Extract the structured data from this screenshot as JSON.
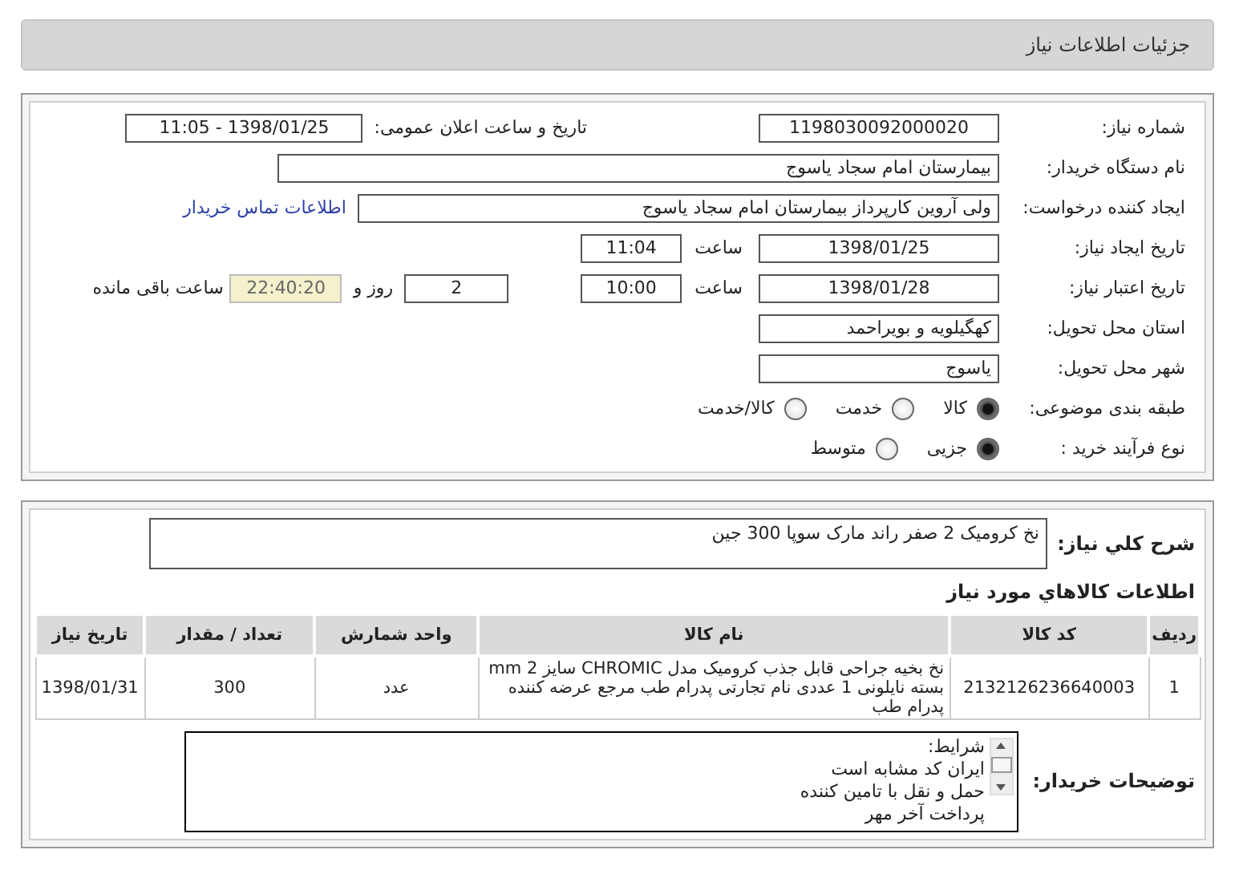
{
  "header": {
    "title": "جزئیات اطلاعات نیاز"
  },
  "need_number": {
    "label": "شماره نیاز:",
    "value": "1198030092000020"
  },
  "announce": {
    "label": "تاریخ و ساعت اعلان عمومی:",
    "value": "1398/01/25 - 11:05"
  },
  "buyer": {
    "label": "نام دستگاه خریدار:",
    "value": "بیمارستان امام سجاد یاسوج"
  },
  "creator": {
    "label": "ایجاد کننده درخواست:",
    "value": "ولی آروین کارپرداز بیمارستان امام سجاد یاسوج",
    "link": "اطلاعات تماس خریدار"
  },
  "created": {
    "label": "تاریخ ایجاد نیاز:",
    "date": "1398/01/25",
    "time_label": "ساعت",
    "time": "11:04"
  },
  "valid": {
    "label": "تاریخ اعتبار نیاز:",
    "date": "1398/01/28",
    "time_label": "ساعت",
    "time": "10:00",
    "days": "2",
    "days_label": "روز و",
    "remaining": "22:40:20",
    "remaining_label": "ساعت باقی مانده"
  },
  "province": {
    "label": "استان محل تحویل:",
    "value": "کهگیلویه و بویراحمد"
  },
  "city": {
    "label": "شهر محل تحویل:",
    "value": "یاسوج"
  },
  "category": {
    "label": "طبقه بندی موضوعی:",
    "options": [
      {
        "label": "کالا",
        "selected": true
      },
      {
        "label": "خدمت",
        "selected": false
      },
      {
        "label": "کالا/خدمت",
        "selected": false
      }
    ]
  },
  "process": {
    "label": "نوع فرآیند خرید :",
    "options": [
      {
        "label": "جزیی",
        "selected": true
      },
      {
        "label": "متوسط",
        "selected": false
      }
    ]
  },
  "summary": {
    "label": "شرح کلي نياز:",
    "value": "نخ کرومیک 2 صفر راند  مارک سوپا 300 جین"
  },
  "goods": {
    "title": "اطلاعات کالاهاي مورد نياز",
    "columns": [
      "ردیف",
      "کد کالا",
      "نام کالا",
      "واحد شمارش",
      "تعداد / مقدار",
      "تاریخ نیاز"
    ],
    "rows": [
      [
        "1",
        "2132126236640003",
        "نخ بخیه جراحی قابل جذب کرومیک مدل CHROMIC سایز 2 mm بسته نایلونی 1 عددی نام تجارتی پدرام طب مرجع عرضه کننده پدرام طب",
        "عدد",
        "300",
        "1398/01/31"
      ]
    ]
  },
  "notes": {
    "label": "توضیحات خریدار:",
    "lines": [
      "شرایط:",
      "ایران کد مشابه است",
      "حمل و نقل با تامین کننده",
      "پرداخت آخر مهر"
    ]
  }
}
